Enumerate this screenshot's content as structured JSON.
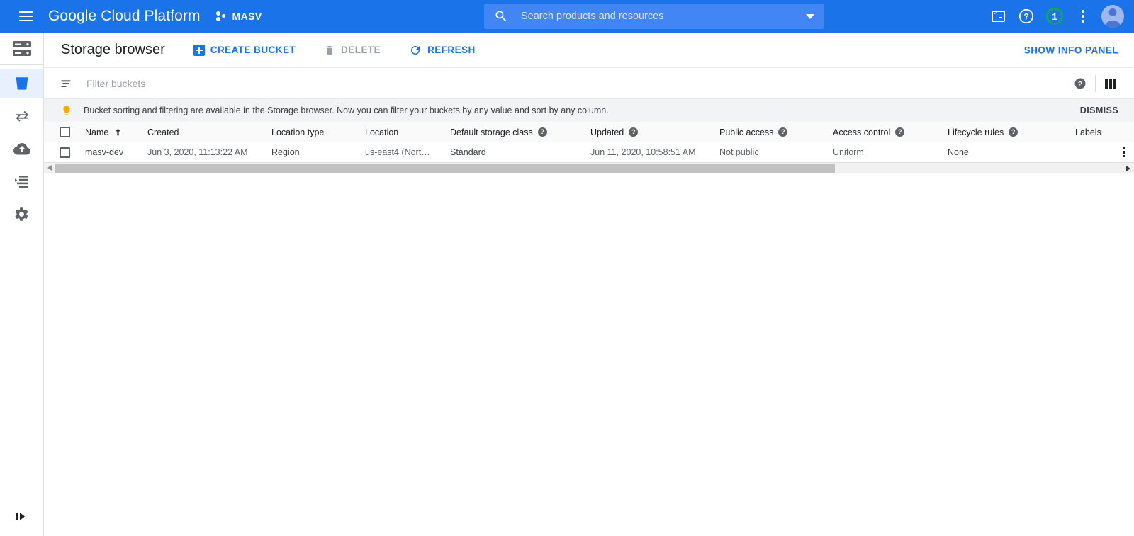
{
  "header": {
    "menu_icon": "hamburger-menu-icon",
    "brand": "Google Cloud Platform",
    "project_name": "MASV",
    "project_icon": "project-dots-icon",
    "search": {
      "placeholder": "Search products and resources",
      "value": "",
      "icon": "search-icon",
      "caret_icon": "chevron-down-icon"
    },
    "actions": {
      "cloud_shell": "cloud-shell-icon",
      "help": "help-icon",
      "notifications_count": "1",
      "more": "vertical-dots-icon",
      "account": "user-avatar"
    }
  },
  "rail": {
    "items": [
      {
        "name": "storage-overview",
        "icon": "server-storage-icon",
        "active": false
      },
      {
        "name": "browser",
        "icon": "bucket-icon",
        "active": true
      },
      {
        "name": "transfer",
        "icon": "transfer-arrows-icon",
        "active": false
      },
      {
        "name": "transfer-for-on-premises",
        "icon": "cloud-upload-icon",
        "active": false
      },
      {
        "name": "transfer-appliance",
        "icon": "list-detail-icon",
        "active": false
      },
      {
        "name": "settings",
        "icon": "gear-icon",
        "active": false
      }
    ],
    "expand_icon": "expand-panel-icon"
  },
  "toolbar": {
    "title": "Storage browser",
    "create_bucket_label": "CREATE BUCKET",
    "create_bucket_icon": "plus-square-icon",
    "delete_label": "DELETE",
    "delete_icon": "trash-icon",
    "delete_disabled": true,
    "refresh_label": "REFRESH",
    "refresh_icon": "refresh-icon",
    "info_panel_label": "SHOW INFO PANEL"
  },
  "filter": {
    "icon": "filter-icon",
    "placeholder": "Filter buckets",
    "value": "",
    "help_icon": "help-filled-icon",
    "columns_icon": "column-display-icon"
  },
  "banner": {
    "icon": "lightbulb-icon",
    "text": "Bucket sorting and filtering are available in the Storage browser. Now you can filter your buckets by any value and sort by any column.",
    "dismiss_label": "DISMISS"
  },
  "table": {
    "columns": [
      {
        "key": "name",
        "label": "Name",
        "help": false,
        "sorted": "asc"
      },
      {
        "key": "created",
        "label": "Created",
        "help": false
      },
      {
        "key": "loctype",
        "label": "Location type",
        "help": false
      },
      {
        "key": "loc",
        "label": "Location",
        "help": false
      },
      {
        "key": "class",
        "label": "Default storage class",
        "help": true
      },
      {
        "key": "updated",
        "label": "Updated",
        "help": true
      },
      {
        "key": "public",
        "label": "Public access",
        "help": true
      },
      {
        "key": "access",
        "label": "Access control",
        "help": true
      },
      {
        "key": "life",
        "label": "Lifecycle rules",
        "help": true
      },
      {
        "key": "labels",
        "label": "Labels",
        "help": false
      }
    ],
    "rows": [
      {
        "selected": false,
        "name": "masv-dev",
        "created": "Jun 3, 2020, 11:13:22 AM",
        "loctype": "Region",
        "loc": "us-east4 (Nort…",
        "class": "Standard",
        "updated": "Jun 11, 2020, 10:58:51 AM",
        "public": "Not public",
        "access": "Uniform",
        "life": "None",
        "labels": "",
        "menu_icon": "row-more-options-icon"
      }
    ],
    "scrollbar": {
      "left_arrow_icon": "scroll-left-arrow-icon",
      "right_arrow_icon": "scroll-right-arrow-icon"
    }
  },
  "colors": {
    "header_blue": "#1a73e8",
    "search_blue": "#4285f4",
    "link_blue": "#1a73e8",
    "active_nav_bg": "#e8f0fe",
    "banner_bg": "#f1f3f4",
    "badge_green": "#13a463",
    "bulb_orange": "#f9ab00",
    "muted_text": "#5f6368"
  }
}
